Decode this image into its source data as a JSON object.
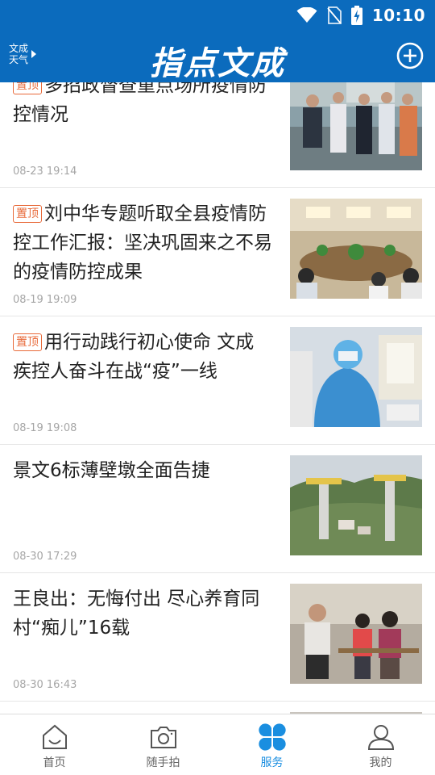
{
  "status_bar": {
    "time": "10:10",
    "icons": [
      "wifi-icon",
      "no-sim-icon",
      "battery-charging-icon"
    ]
  },
  "header": {
    "weather_line1": "文成",
    "weather_line2": "天气",
    "title": "指点文成",
    "add_icon": "plus-circle-icon"
  },
  "colors": {
    "brand_blue": "#0b6bbd",
    "pin_orange": "#e86a3a",
    "active_tab": "#1a8ee0"
  },
  "news": [
    {
      "pinned": true,
      "pin_label": "置顶",
      "title": "多招政督查重点场所疫情防控情况",
      "time": "08-23 19:14",
      "thumb": "officials-inspection-photo"
    },
    {
      "pinned": true,
      "pin_label": "置顶",
      "title": "刘中华专题听取全县疫情防控工作汇报：坚决巩固来之不易的疫情防控成果",
      "time": "08-19 19:09",
      "thumb": "meeting-room-photo"
    },
    {
      "pinned": true,
      "pin_label": "置顶",
      "title": "用行动践行初心使命 文成疾控人奋斗在战“疫”一线",
      "time": "08-19 19:08",
      "thumb": "medical-worker-photo"
    },
    {
      "pinned": false,
      "pin_label": "",
      "title": "景文6标薄壁墩全面告捷",
      "time": "08-30 17:29",
      "thumb": "bridge-construction-photo"
    },
    {
      "pinned": false,
      "pin_label": "",
      "title": "王良出：无悔付出 尽心养育同村“痴儿”16载",
      "time": "08-30 16:43",
      "thumb": "family-portrait-photo"
    }
  ],
  "bottom_nav": [
    {
      "label": "首页",
      "icon": "home-icon",
      "active": false
    },
    {
      "label": "随手拍",
      "icon": "camera-icon",
      "active": false
    },
    {
      "label": "服务",
      "icon": "clover-icon",
      "active": true
    },
    {
      "label": "我的",
      "icon": "person-icon",
      "active": false
    }
  ]
}
